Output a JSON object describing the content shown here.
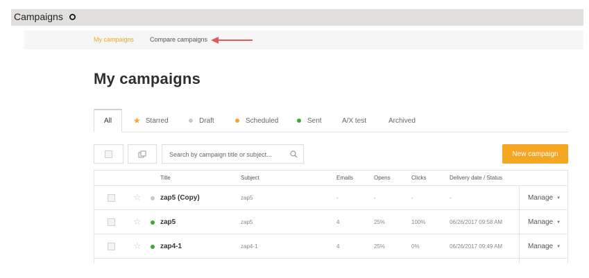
{
  "topbar": {
    "title": "Campaigns"
  },
  "subnav": {
    "active": "My campaigns",
    "other": "Compare campaigns"
  },
  "heading": "My campaigns",
  "tabs": [
    {
      "label": "All"
    },
    {
      "label": "Starred",
      "icon": "star-icon",
      "color": "#f5a623"
    },
    {
      "label": "Draft",
      "color": "#c8c8c8"
    },
    {
      "label": "Scheduled",
      "color": "#f5a623"
    },
    {
      "label": "Sent",
      "color": "#3fa535"
    },
    {
      "label": "A/X test"
    },
    {
      "label": "Archived"
    }
  ],
  "search": {
    "placeholder": "Search by campaign title or subject..."
  },
  "new_campaign": "New campaign",
  "table": {
    "headers": {
      "title": "Title",
      "subject": "Subject",
      "emails": "Emails",
      "opens": "Opens",
      "clicks": "Clicks",
      "delivery": "Delivery date / Status"
    },
    "rows": [
      {
        "title": "zap5 (Copy)",
        "subject": "zap5",
        "emails": "-",
        "opens": "-",
        "clicks": "-",
        "delivery": "-",
        "status_color": "#c8c8c8",
        "manage": "Manage"
      },
      {
        "title": "zap5",
        "subject": "zap5",
        "emails": "4",
        "opens": "25%",
        "clicks": "100%",
        "delivery": "06/26/2017 09:58 AM",
        "status_color": "#3fa535",
        "manage": "Manage"
      },
      {
        "title": "zap4-1",
        "subject": "zap4-1",
        "emails": "4",
        "opens": "25%",
        "clicks": "0%",
        "delivery": "06/26/2017 09:49 AM",
        "status_color": "#3fa535",
        "manage": "Manage"
      }
    ]
  },
  "colors": {
    "accent": "#f5a623",
    "sent": "#3fa535",
    "draft": "#c8c8c8",
    "annotation_arrow": "#e05a5a"
  }
}
